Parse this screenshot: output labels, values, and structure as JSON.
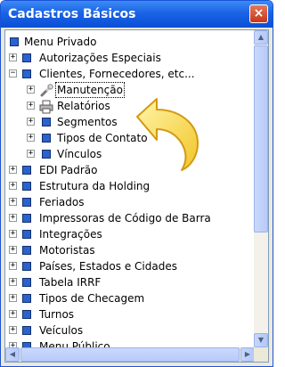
{
  "window": {
    "title": "Cadastros Básicos",
    "close_glyph": "×"
  },
  "tree": {
    "root": "Menu Privado",
    "items": [
      "Autorizações Especiais",
      "Clientes, Fornecedores, etc...",
      "Manutenção",
      "Relatórios",
      "Segmentos",
      "Tipos de Contato",
      "Vínculos",
      "EDI Padrão",
      "Estrutura da Holding",
      "Feriados",
      "Impressoras de Código de Barra",
      "Integrações",
      "Motoristas",
      "Países, Estados e Cidades",
      "Tabela IRRF",
      "Tipos de Checagem",
      "Turnos",
      "Veículos",
      "Menu Público"
    ]
  },
  "colors": {
    "title_bar": "#0a4fd6",
    "node_icon": "#2a62ce",
    "arrow": "#f7d54a"
  },
  "icons": {
    "root": "tree-node-icon",
    "manutencao": "wrench-icon",
    "relatorios": "printer-icon",
    "pointer": "curved-arrow-icon"
  }
}
